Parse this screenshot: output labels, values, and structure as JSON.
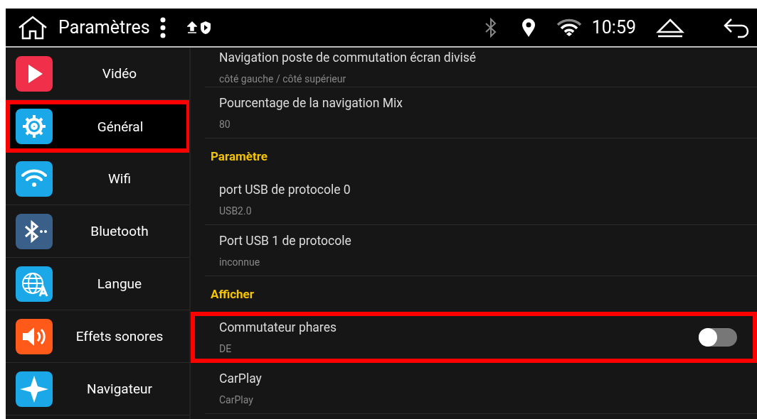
{
  "status_bar": {
    "title": "Paramètres",
    "time": "10:59"
  },
  "sidebar": {
    "items": [
      {
        "label": "Vidéo",
        "kind": "video",
        "selected": false,
        "highlighted": false
      },
      {
        "label": "Général",
        "kind": "gear",
        "selected": true,
        "highlighted": true
      },
      {
        "label": "Wifi",
        "kind": "wifi",
        "selected": false,
        "highlighted": false
      },
      {
        "label": "Bluetooth",
        "kind": "bluetooth",
        "selected": false,
        "highlighted": false
      },
      {
        "label": "Langue",
        "kind": "language",
        "selected": false,
        "highlighted": false
      },
      {
        "label": "Effets sonores",
        "kind": "sound",
        "selected": false,
        "highlighted": false
      },
      {
        "label": "Navigateur",
        "kind": "compass",
        "selected": false,
        "highlighted": false
      }
    ]
  },
  "settings": [
    {
      "kind": "row",
      "title": "Navigation poste de commutation écran divisé",
      "value": "côté gauche / côté supérieur",
      "highlighted": false
    },
    {
      "kind": "row",
      "title": "Pourcentage de la navigation Mix",
      "value": "80",
      "highlighted": false
    },
    {
      "kind": "header",
      "title": "Paramètre"
    },
    {
      "kind": "row",
      "title": "port USB de protocole 0",
      "value": "USB2.0",
      "highlighted": false
    },
    {
      "kind": "row",
      "title": "Port USB 1 de protocole",
      "value": "inconnue",
      "highlighted": false
    },
    {
      "kind": "header",
      "title": "Afficher"
    },
    {
      "kind": "switch",
      "title": "Commutateur phares",
      "value": "DE",
      "on": false,
      "highlighted": true
    },
    {
      "kind": "row",
      "title": "CarPlay",
      "value": "CarPlay",
      "highlighted": false
    }
  ]
}
